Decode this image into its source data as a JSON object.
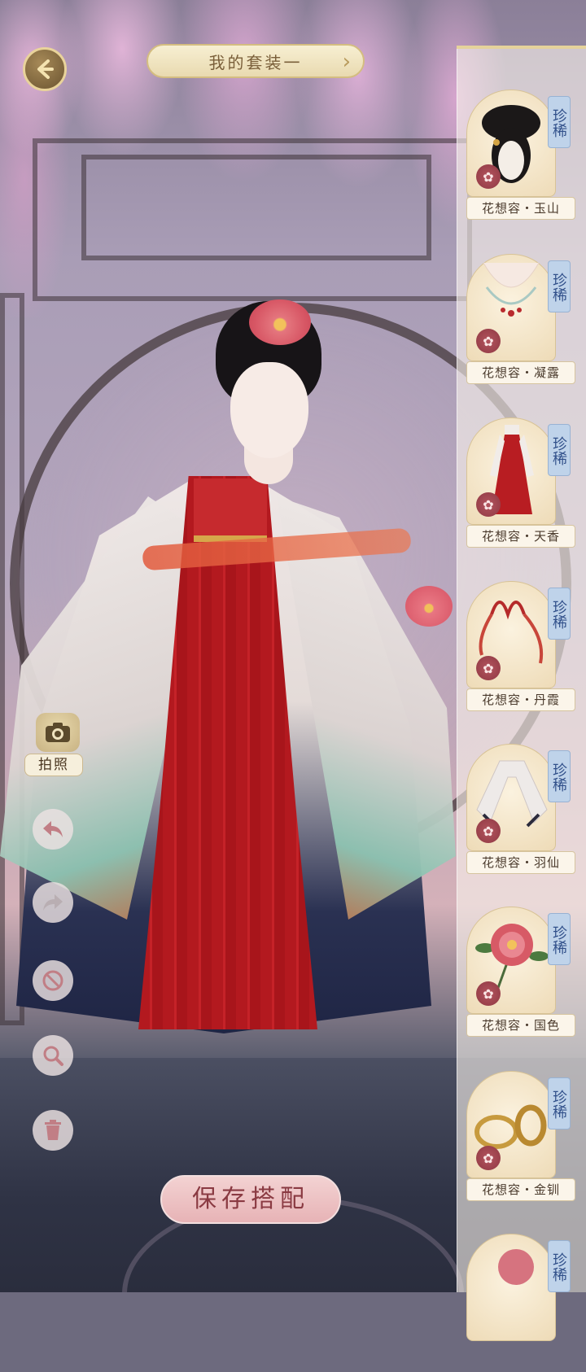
{
  "header": {
    "back_icon": "back-arrow-icon",
    "outfit_title": "我的套装一",
    "next_icon": "chevron-right-icon"
  },
  "items": [
    {
      "rarity": "珍稀",
      "name": "花想容・玉山",
      "kind": "hairstyle"
    },
    {
      "rarity": "珍稀",
      "name": "花想容・凝露",
      "kind": "necklace"
    },
    {
      "rarity": "珍稀",
      "name": "花想容・天香",
      "kind": "dress"
    },
    {
      "rarity": "珍稀",
      "name": "花想容・丹霞",
      "kind": "ribbon"
    },
    {
      "rarity": "珍稀",
      "name": "花想容・羽仙",
      "kind": "sleeves"
    },
    {
      "rarity": "珍稀",
      "name": "花想容・国色",
      "kind": "peony"
    },
    {
      "rarity": "珍稀",
      "name": "花想容・金钏",
      "kind": "bracelet"
    },
    {
      "rarity": "珍稀",
      "name": "",
      "kind": "partial"
    }
  ],
  "tools": {
    "camera_label": "拍照",
    "icons": [
      "undo-icon",
      "redo-icon",
      "clear-icon",
      "zoom-icon",
      "trash-icon"
    ]
  },
  "footer": {
    "save_label": "保存搭配"
  },
  "colors": {
    "gold": "#e9d39a",
    "rare_badge": "#bfd3ea",
    "save_button": "#e7b3b6"
  }
}
